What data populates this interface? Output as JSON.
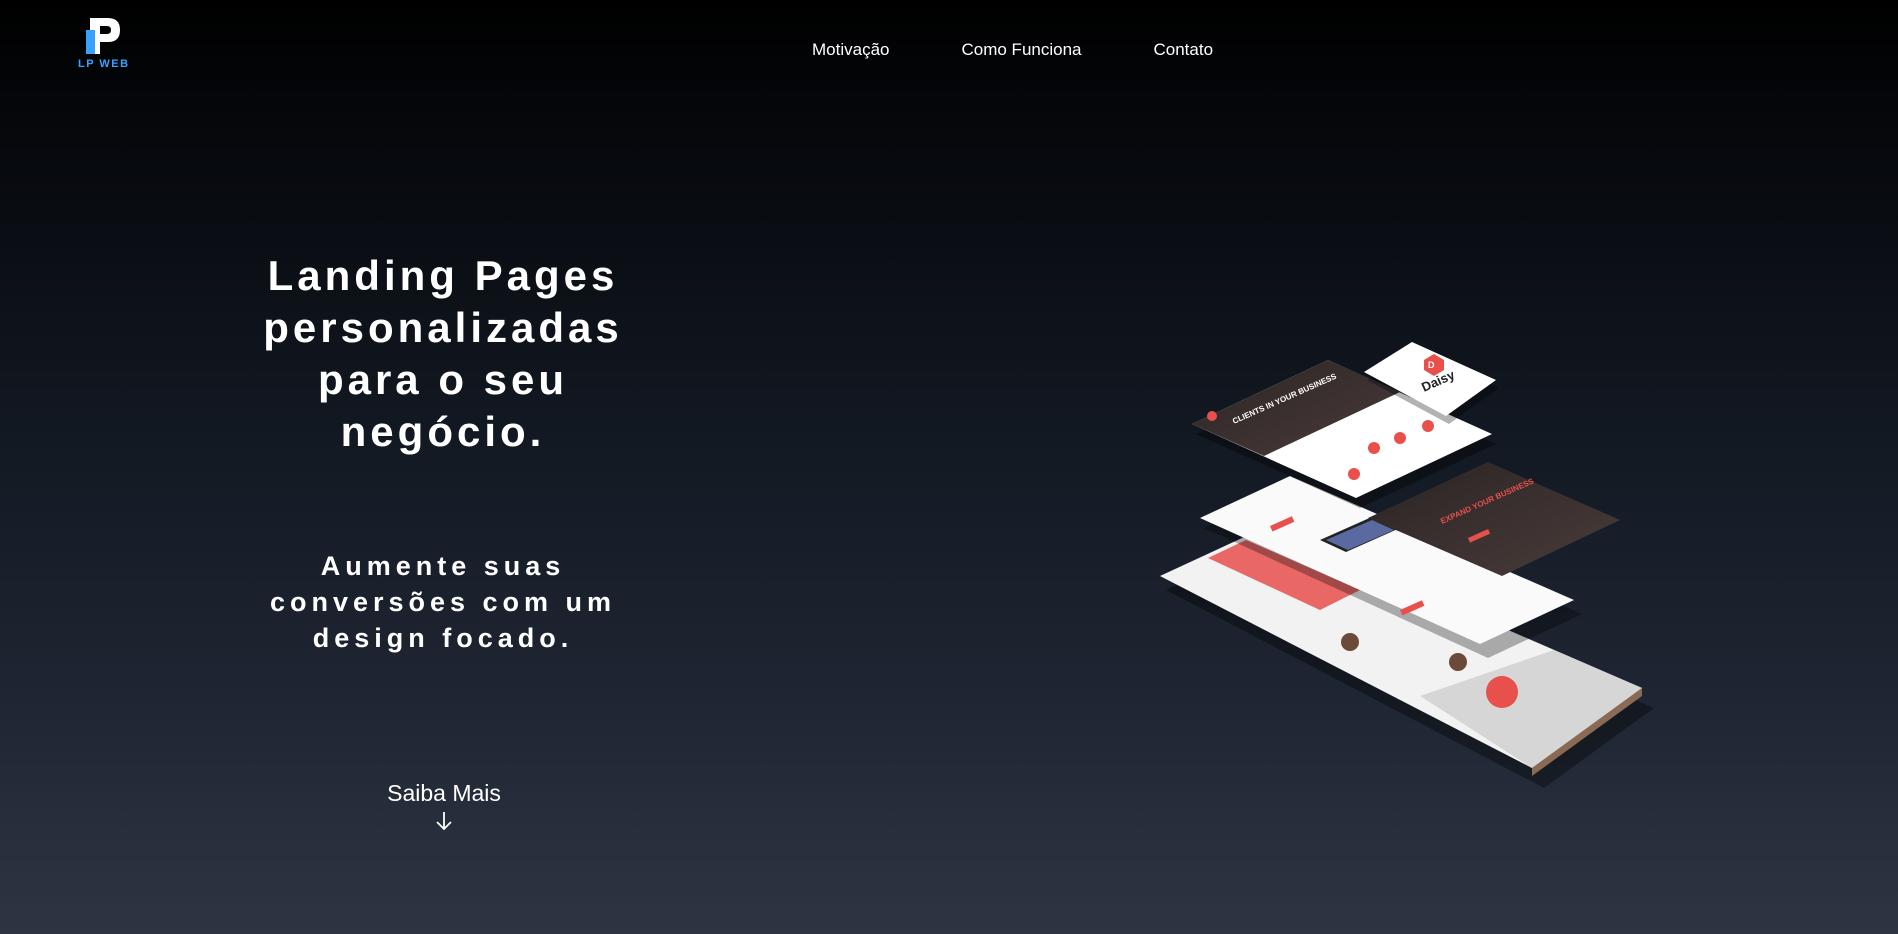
{
  "brand": {
    "logo_text": "LP WEB",
    "accent": "#3aa0ff"
  },
  "nav": {
    "items": [
      "Motivação",
      "Como Funciona",
      "Contato"
    ]
  },
  "hero": {
    "title_lines": [
      "Landing Pages",
      "personalizadas",
      "para o seu",
      "negócio."
    ],
    "subtitle_lines": [
      "Aumente suas",
      "conversões com um",
      "design focado."
    ]
  },
  "cta": {
    "label": "Saiba Mais",
    "icon": "arrow-down-icon"
  },
  "mockup": {
    "brand_name": "Daisy",
    "headline_1": "CLIENTS IN YOUR BUSINESS",
    "headline_2": "EXPAND YOUR BUSINESS",
    "accent": "#e8504c"
  }
}
